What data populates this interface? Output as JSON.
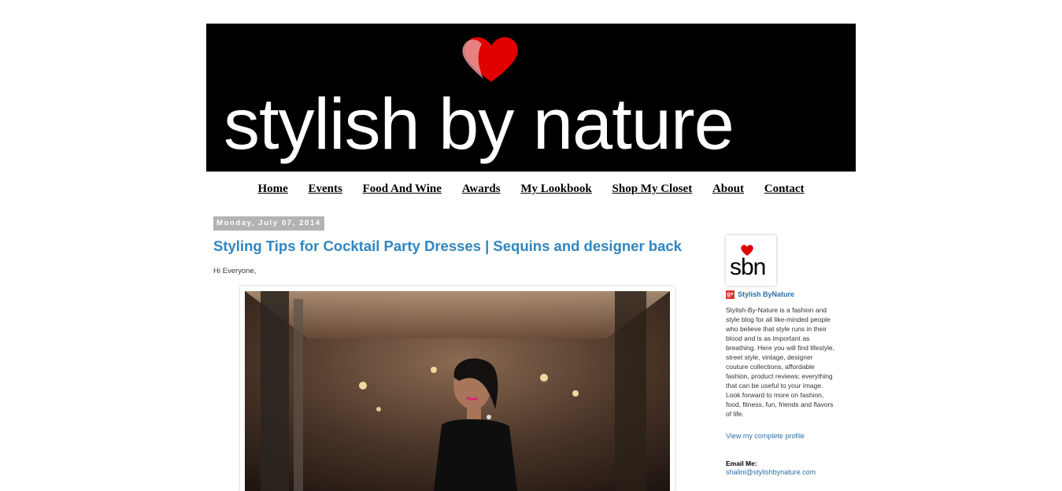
{
  "header": {
    "logo_text": "stylish by nature"
  },
  "nav": {
    "items": [
      {
        "label": "Home"
      },
      {
        "label": "Events"
      },
      {
        "label": "Food And Wine"
      },
      {
        "label": "Awards"
      },
      {
        "label": "My Lookbook"
      },
      {
        "label": "Shop My Closet"
      },
      {
        "label": "About"
      },
      {
        "label": "Contact"
      }
    ]
  },
  "post": {
    "date": "Monday, July 07, 2014",
    "title": "Styling Tips for Cocktail Party Dresses | Sequins and designer back",
    "greeting": "Hi Everyone,"
  },
  "sidebar": {
    "profile_logo": "sbn",
    "profile_name": "Stylish ByNature",
    "bio": "Stylish-By-Nature is a fashion and style blog for all like-minded people who believe that style runs in their blood and is as important as breathing. Here you will find lifestyle, street style, vintage, designer couture collections, affordable fashion, product reviews; everything that can be useful to your image. Look forward to more on fashion, food, fitness, fun, friends and flavors of life.",
    "view_profile": "View my complete profile",
    "email_label": "Email Me:",
    "email": "shalini@stylishbynature.com"
  },
  "colors": {
    "accent": "#2f86c1",
    "heart": "#e00000",
    "banner_bg": "#000000"
  }
}
